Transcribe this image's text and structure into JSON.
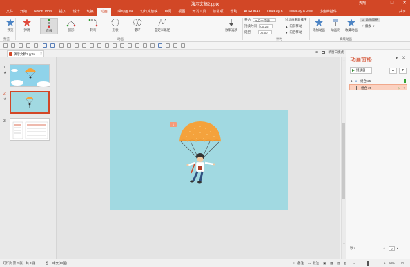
{
  "window": {
    "title": "演示文稿2.pptx",
    "user": "天翔",
    "controls": [
      "—",
      "□",
      "✕"
    ]
  },
  "menu": {
    "items": [
      "文件",
      "开始",
      "Nordri Tools",
      "插入",
      "设计",
      "切换",
      "动画",
      "口袋动画 PA",
      "幻灯片放映",
      "审阅",
      "视图",
      "开发工具",
      "加载项",
      "帮助",
      "ACROBAT",
      "OneKey 8",
      "OneKey 8 Plus",
      "小蜜蜂插件"
    ],
    "active_index": 6,
    "share": "共享"
  },
  "ribbon": {
    "preview": {
      "label": "预览",
      "group": "预览"
    },
    "animations": [
      {
        "label": "弹跳",
        "icon": "bounce-star-icon"
      },
      {
        "label": "直线",
        "icon": "line-path-icon"
      },
      {
        "label": "弧形",
        "icon": "arc-path-icon"
      },
      {
        "label": "转弯",
        "icon": "turn-path-icon"
      },
      {
        "label": "形状",
        "icon": "shape-path-icon"
      },
      {
        "label": "循环",
        "icon": "loop-path-icon"
      },
      {
        "label": "自定义路径",
        "icon": "custom-path-icon"
      }
    ],
    "selected_animation_index": 1,
    "animation_group": "动画",
    "effect_options": "效果选项",
    "timing": {
      "start_label": "开始:",
      "start_value": "与上一动画...",
      "duration_label": "持续时间:",
      "duration_value": "00.25",
      "delay_label": "延迟:",
      "delay_value": "00.50",
      "reorder_title": "对动画重新排序",
      "move_earlier": "向前移动",
      "move_later": "向后移动",
      "group": "计时"
    },
    "advanced": {
      "add_animation": "添加动画",
      "animation_painter": "动画刷",
      "collect_animation": "收藏动画",
      "animation_pane": "动画窗格",
      "trigger": "触发",
      "group": "高级动画"
    }
  },
  "tabs": {
    "document": "演示文稿2.pptx",
    "new_window": "新窗口模式"
  },
  "slides": [
    {
      "number": "1",
      "star": "★"
    },
    {
      "number": "2",
      "star": "★"
    },
    {
      "number": "3",
      "star": ""
    }
  ],
  "selected_slide": 2,
  "slide_canvas": {
    "anim_tag": "1",
    "background": "#a1d9e1"
  },
  "anim_pane": {
    "title": "动画窗格",
    "play": "播放自",
    "items": [
      {
        "index": "1",
        "name": "组合 25"
      },
      {
        "index": "",
        "name": "组合 25"
      }
    ],
    "seconds": "秒 ▾"
  },
  "status": {
    "slide_info": "幻灯片 第 2 张，共 3 张",
    "language": "中文(中国)",
    "notes": "备注",
    "comments": "批注",
    "zoom": "50%"
  },
  "colors": {
    "accent": "#d24726",
    "parachute": "#f4a23c",
    "sky": "#a1d9e1"
  }
}
